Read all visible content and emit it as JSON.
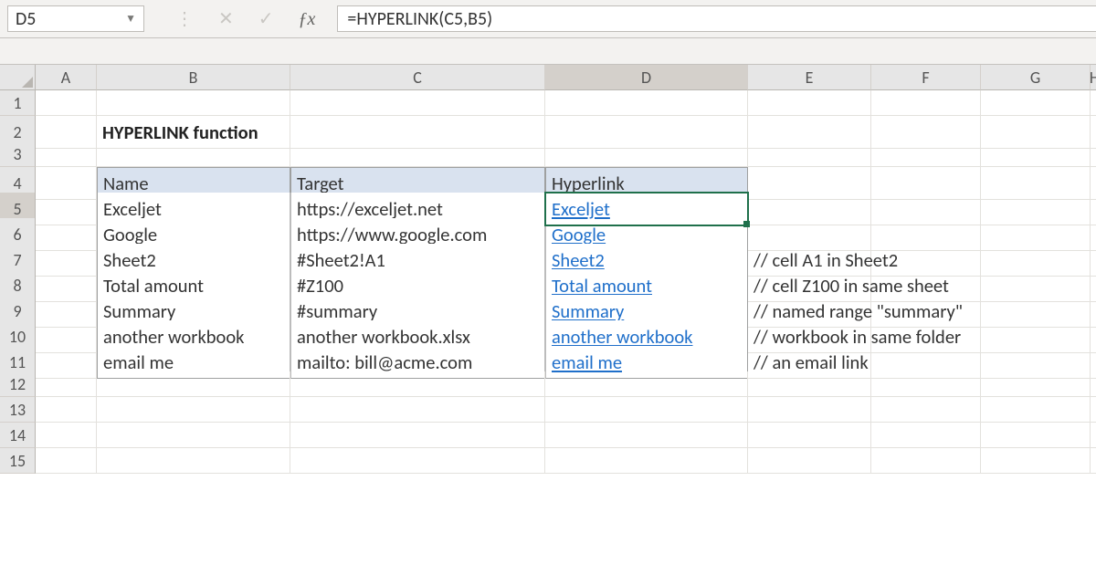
{
  "namebox": {
    "value": "D5"
  },
  "formula_bar": {
    "formula": "=HYPERLINK(C5,B5)"
  },
  "columns": [
    "A",
    "B",
    "C",
    "D",
    "E",
    "F",
    "G",
    "H"
  ],
  "rows": [
    "1",
    "2",
    "3",
    "4",
    "5",
    "6",
    "7",
    "8",
    "9",
    "10",
    "11",
    "12",
    "13",
    "14",
    "15"
  ],
  "title": "HYPERLINK function",
  "table": {
    "headers": {
      "name": "Name",
      "target": "Target",
      "hyperlink": "Hyperlink"
    },
    "rows": [
      {
        "name": "Exceljet",
        "target": "https://exceljet.net",
        "hyperlink": "Exceljet",
        "comment": ""
      },
      {
        "name": "Google",
        "target": "https://www.google.com",
        "hyperlink": "Google",
        "comment": ""
      },
      {
        "name": "Sheet2",
        "target": "#Sheet2!A1",
        "hyperlink": "Sheet2",
        "comment": "// cell A1 in  Sheet2"
      },
      {
        "name": "Total amount",
        "target": "#Z100",
        "hyperlink": "Total amount",
        "comment": "// cell Z100 in same sheet"
      },
      {
        "name": "Summary",
        "target": "#summary",
        "hyperlink": "Summary",
        "comment": "// named range \"summary\""
      },
      {
        "name": "another workbook",
        "target": "another workbook.xlsx",
        "hyperlink": "another workbook",
        "comment": "// workbook in same folder"
      },
      {
        "name": "email me",
        "target": "mailto: bill@acme.com",
        "hyperlink": "email me",
        "comment": "// an email link"
      }
    ]
  },
  "selected_cell": "D5"
}
